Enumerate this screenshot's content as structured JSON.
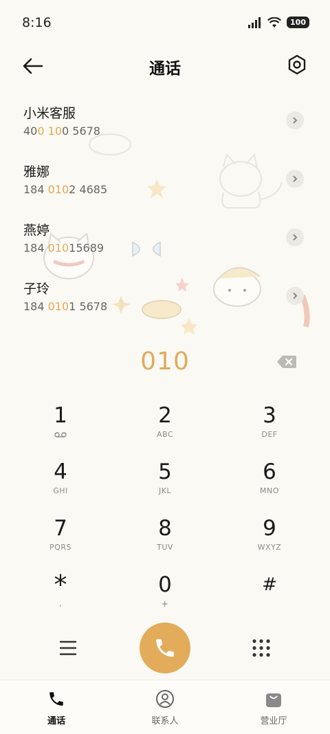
{
  "status_bar": {
    "time": "8:16",
    "battery": "100"
  },
  "header": {
    "title": "通话"
  },
  "contacts": [
    {
      "name": "小米客服",
      "number_parts": [
        "40",
        "0",
        " ",
        "10",
        "0 5678"
      ]
    },
    {
      "name": "雅娜",
      "number_parts": [
        "184 ",
        "010",
        "2 4685"
      ]
    },
    {
      "name": "燕婷",
      "number_parts": [
        "184 ",
        "010",
        "15689"
      ]
    },
    {
      "name": "子玲",
      "number_parts": [
        "184 ",
        "010",
        "1 5678"
      ]
    }
  ],
  "dialer": {
    "input": "010",
    "keys": [
      [
        {
          "digit": "1",
          "sub": "voicemail-icon"
        },
        {
          "digit": "2",
          "sub": "ABC"
        },
        {
          "digit": "3",
          "sub": "DEF"
        }
      ],
      [
        {
          "digit": "4",
          "sub": "GHI"
        },
        {
          "digit": "5",
          "sub": "JKL"
        },
        {
          "digit": "6",
          "sub": "MNO"
        }
      ],
      [
        {
          "digit": "7",
          "sub": "PQRS"
        },
        {
          "digit": "8",
          "sub": "TUV"
        },
        {
          "digit": "9",
          "sub": "WXYZ"
        }
      ],
      [
        {
          "digit": "*",
          "sub": ","
        },
        {
          "digit": "0",
          "sub": "+"
        },
        {
          "digit": "#",
          "sub": ""
        }
      ]
    ]
  },
  "bottom_nav": [
    {
      "label": "通话",
      "icon": "phone-icon",
      "active": true
    },
    {
      "label": "联系人",
      "icon": "person-circle-icon",
      "active": false
    },
    {
      "label": "营业厅",
      "icon": "shopping-bag-icon",
      "active": false
    }
  ],
  "colors": {
    "accent": "#e2ac5b",
    "highlight": "#e0aa55",
    "background": "#fbf9f3"
  }
}
